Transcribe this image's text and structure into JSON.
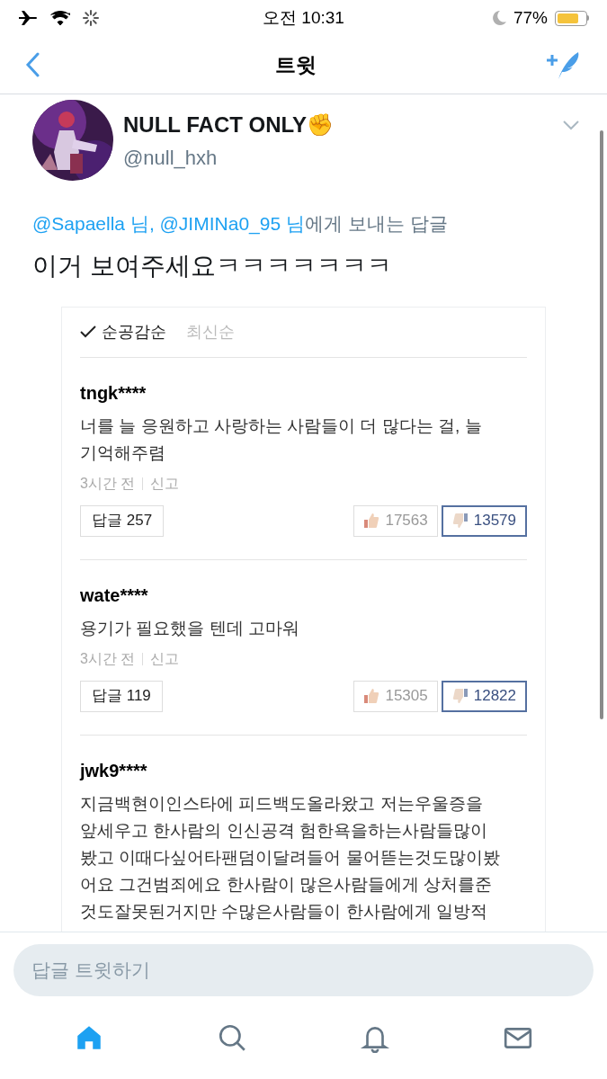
{
  "status_bar": {
    "time": "오전 10:31",
    "battery_text": "77%"
  },
  "header": {
    "title": "트윗"
  },
  "tweet": {
    "display_name": "NULL FACT ONLY✊",
    "handle": "@null_hxh",
    "reply_context": [
      {
        "kind": "link",
        "text": "@Sapaella 님, @JIMINa0_95 님"
      },
      {
        "kind": "plain",
        "text": "에게 보내는 답글"
      }
    ],
    "text": "이거 보여주세요ㅋㅋㅋㅋㅋㅋㅋ",
    "attached_image": {
      "sort_options": [
        {
          "label": "순공감순",
          "selected": true
        },
        {
          "label": "최신순",
          "selected": false
        }
      ],
      "comments": [
        {
          "user": "tngk****",
          "text": "너를 늘 응원하고 사랑하는 사람들이 더 많다는 걸, 늘\n기억해주렴",
          "time": "3시간 전",
          "report": "신고",
          "reply_button": "답글 257",
          "likes": "17563",
          "dislikes": "13579"
        },
        {
          "user": "wate****",
          "text": "용기가 필요했을 텐데 고마워",
          "time": "3시간 전",
          "report": "신고",
          "reply_button": "답글 119",
          "likes": "15305",
          "dislikes": "12822"
        },
        {
          "user": "jwk9****",
          "text": "지금백현이인스타에 피드백도올라왔고 저는우울증을\n앞세우고 한사람의 인신공격 험한욕을하는사람들많이\n봤고 이때다싶어타팬덤이달려들어 물어뜯는것도많이봤\n어요 그건범죄에요 한사람이 많은사람들에게 상처를준\n것도잘못된거지만 수많은사람들이 한사람에게 일방적"
        }
      ]
    }
  },
  "reply_field": {
    "placeholder": "답글 트윗하기"
  },
  "tab_bar": [
    {
      "kind": "home",
      "selected": true
    },
    {
      "kind": "search",
      "selected": false
    },
    {
      "kind": "notifications",
      "selected": false
    },
    {
      "kind": "messages",
      "selected": false
    }
  ]
}
